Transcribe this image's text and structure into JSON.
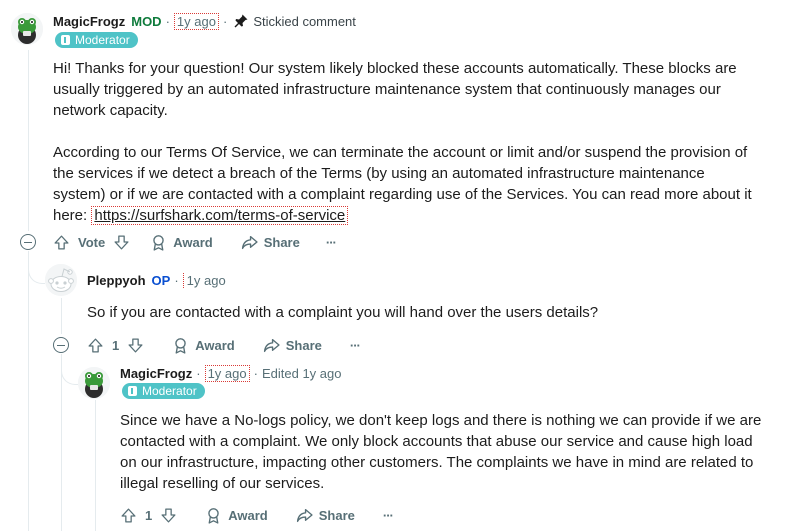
{
  "comments": [
    {
      "username": "MagicFrogz",
      "role_tag": "MOD",
      "time": "1y ago",
      "stickied_label": "Stickied comment",
      "flair": "Moderator",
      "paragraph1": "Hi! Thanks for your question! Our system likely blocked these accounts automatically. These blocks are usually triggered by an automated infrastructure maintenance system that continuously manages our network capacity.",
      "paragraph2_lines": [
        "According to our Terms Of Service, we can terminate the account or limit and/or suspend the provision of",
        "the services if we detect a breach of the Terms (by using an automated infrastructure maintenance",
        "system) or if we are contacted with a complaint regarding use of the Services. You can read more about it"
      ],
      "link_prefix": "here: ",
      "link_text": "https://surfshark.com/terms-of-service",
      "vote_label": "Vote",
      "award_label": "Award",
      "share_label": "Share",
      "more_label": "···"
    },
    {
      "username": "Pleppyoh",
      "role_tag": "OP",
      "time": "1y ago",
      "text": "So if you are contacted with a complaint you will hand over the users details?",
      "vote_count": "1",
      "award_label": "Award",
      "share_label": "Share",
      "more_label": "···"
    },
    {
      "username": "MagicFrogz",
      "time": "1y ago",
      "edited": "Edited 1y ago",
      "flair": "Moderator",
      "text": "Since we have a No-logs policy, we don't keep logs and there is nothing we can provide if we are contacted with a complaint. We only block accounts that abuse our service and cause high load on our infrastructure, impacting other customers. The complaints we have in mind are related to illegal reselling of our services.",
      "vote_count": "1",
      "award_label": "Award",
      "share_label": "Share",
      "more_label": "···"
    }
  ],
  "colors": {
    "flair_bg": "#4fc3c7",
    "mod_green": "#0f7b3c",
    "op_blue": "#0a4fd1",
    "meta_gray": "#576f76",
    "thread_line": "#e5ebee"
  },
  "icons": [
    "frog-avatar",
    "snoo-avatar",
    "pin-icon",
    "upvote-icon",
    "downvote-icon",
    "award-icon",
    "share-icon",
    "more-icon",
    "collapse-icon",
    "flair-icon"
  ]
}
